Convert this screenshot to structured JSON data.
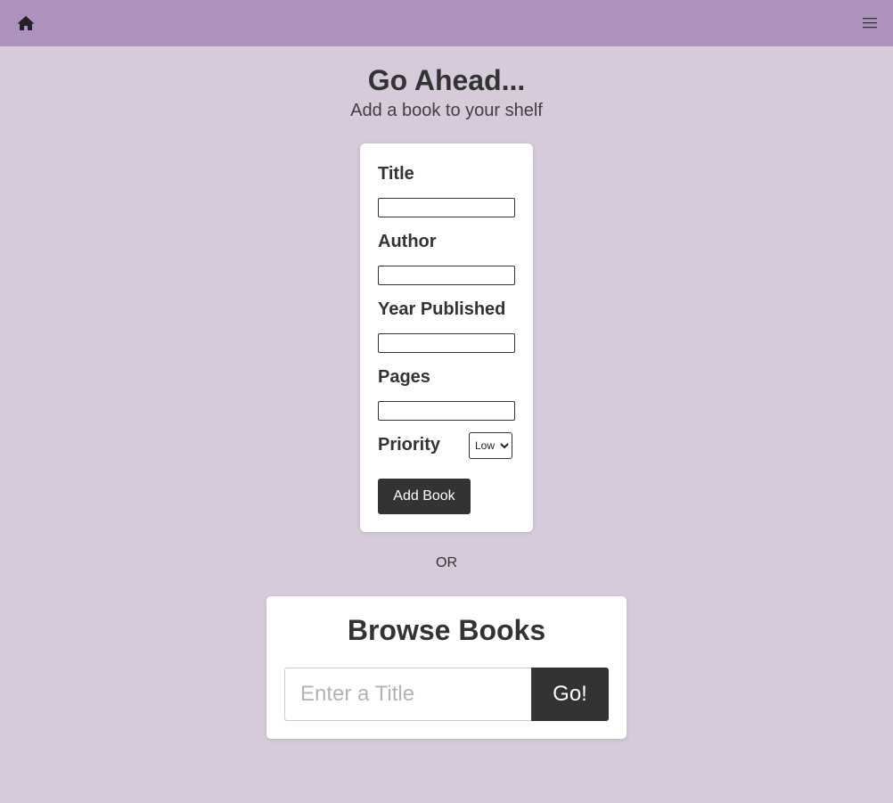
{
  "nav": {
    "home_icon": "home-icon",
    "menu_icon": "hamburger-menu-icon"
  },
  "header": {
    "title": "Go Ahead...",
    "subtitle": "Add a book to your shelf"
  },
  "form": {
    "title_label": "Title",
    "title_value": "",
    "author_label": "Author",
    "author_value": "",
    "year_label": "Year Published",
    "year_value": "",
    "pages_label": "Pages",
    "pages_value": "",
    "priority_label": "Priority",
    "priority_selected": "Low",
    "submit_label": "Add Book"
  },
  "divider_text": "OR",
  "browse": {
    "title": "Browse Books",
    "search_placeholder": "Enter a Title",
    "search_value": "",
    "go_label": "Go!"
  },
  "colors": {
    "nav_bg": "#ae92be",
    "page_bg": "#d6cadb",
    "button_bg": "#333333",
    "card_bg": "#ffffff",
    "text": "#333333"
  }
}
